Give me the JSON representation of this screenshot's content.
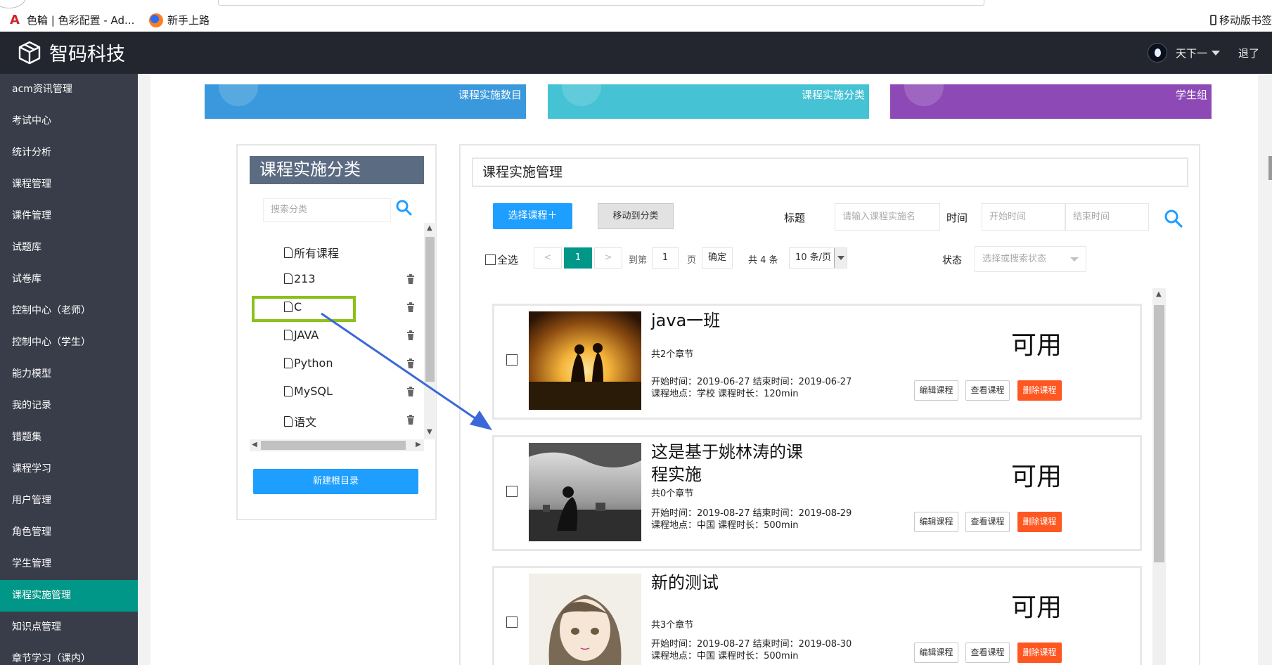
{
  "bookmarks": {
    "items": [
      "色輪 | 色彩配置 - Ad...",
      "新手上路"
    ],
    "mobile": "移动版书签"
  },
  "header": {
    "app_name": "智码科技",
    "user": "天下一",
    "logout": "退了"
  },
  "sidebar": {
    "items": [
      {
        "label": "acm资讯管理"
      },
      {
        "label": "考试中心"
      },
      {
        "label": "统计分析"
      },
      {
        "label": "课程管理"
      },
      {
        "label": "课件管理"
      },
      {
        "label": "试题库"
      },
      {
        "label": "试卷库"
      },
      {
        "label": "控制中心（老师）"
      },
      {
        "label": "控制中心（学生）"
      },
      {
        "label": "能力模型"
      },
      {
        "label": "我的记录"
      },
      {
        "label": "错题集"
      },
      {
        "label": "课程学习"
      },
      {
        "label": "用户管理"
      },
      {
        "label": "角色管理"
      },
      {
        "label": "学生管理"
      },
      {
        "label": "课程实施管理",
        "active": true
      },
      {
        "label": "知识点管理"
      },
      {
        "label": "章节学习（课内）"
      }
    ],
    "active_color": "#009688"
  },
  "cards": [
    {
      "title": "课程实施数目",
      "color": "#3a99dc"
    },
    {
      "title": "课程实施分类",
      "color": "#45c2d4"
    },
    {
      "title": "学生组",
      "color": "#8d49b5"
    }
  ],
  "categories": {
    "header": "课程实施分类",
    "search_placeholder": "搜索分类",
    "items": [
      {
        "label": "所有课程",
        "deletable": false
      },
      {
        "label": "213",
        "deletable": true
      },
      {
        "label": "C",
        "deletable": true,
        "highlighted": true
      },
      {
        "label": "JAVA",
        "deletable": true
      },
      {
        "label": "Python",
        "deletable": true
      },
      {
        "label": "MySQL",
        "deletable": true
      },
      {
        "label": "语文",
        "deletable": true
      }
    ],
    "new_root_label": "新建根目录"
  },
  "management": {
    "title": "课程实施管理",
    "select_course_label": "选择课程＋",
    "move_label": "移动到分类",
    "title_label": "标题",
    "title_placeholder": "请输入课程实施名",
    "time_label": "时间",
    "start_placeholder": "开始时间",
    "end_placeholder": "结束时间",
    "select_all": "全选",
    "pager": {
      "prev": "<",
      "current": "1",
      "next": ">",
      "goto_label": "到第",
      "goto_value": "1",
      "page_unit": "页",
      "confirm": "确定",
      "total": "共 4 条",
      "page_size": "10 条/页"
    },
    "status_label": "状态",
    "status_placeholder": "选择或搜索状态"
  },
  "courses": [
    {
      "title": "java一班",
      "chapters": "共2个章节",
      "dates": "开始时间：2019-06-27 结束时间：2019-06-27",
      "meta": "课程地点：学校  课程时长：120min",
      "status": "可用",
      "edit": "编辑课程",
      "view": "查看课程",
      "delete": "删除课程"
    },
    {
      "title": "这是基于姚林涛的课程实施",
      "chapters": "共0个章节",
      "dates": "开始时间：2019-08-27 结束时间：2019-08-29",
      "meta": "课程地点：中国  课程时长：500min",
      "status": "可用",
      "edit": "编辑课程",
      "view": "查看课程",
      "delete": "删除课程"
    },
    {
      "title": "新的测试",
      "chapters": "共3个章节",
      "dates": "开始时间：2019-08-27 结束时间：2019-08-30",
      "meta": "课程地点：中国  课程时长：500min",
      "status": "可用",
      "edit": "编辑课程",
      "view": "查看课程",
      "delete": "删除课程"
    }
  ],
  "colors": {
    "primary_blue": "#1e9fff",
    "danger": "#ff5722",
    "header_bg": "#23262e",
    "sidebar_bg": "#393d49",
    "highlight": "#8cc11a",
    "arrow": "#3b68d8"
  }
}
